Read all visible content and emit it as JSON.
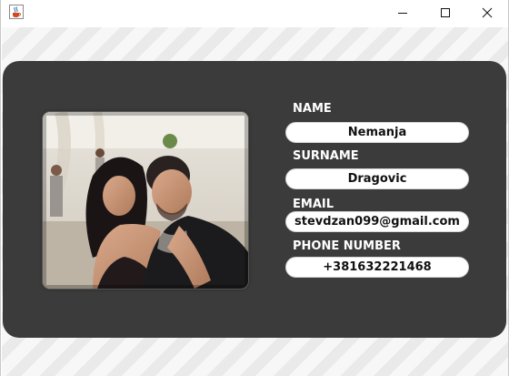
{
  "window": {
    "icon": "java-cup-icon",
    "controls": {
      "minimize_icon": "minimize-icon",
      "maximize_icon": "maximize-icon",
      "close_icon": "close-icon"
    }
  },
  "card": {
    "background_color": "#3b3b3b",
    "photo": {
      "description_icon": "profile-photo"
    },
    "fields": {
      "name": {
        "label": "NAME",
        "value": "Nemanja"
      },
      "surname": {
        "label": "SURNAME",
        "value": "Dragovic"
      },
      "email": {
        "label": "EMAIL",
        "value": "stevdzan099@gmail.com"
      },
      "phone": {
        "label": "PHONE NUMBER",
        "value": "+381632221468"
      }
    }
  }
}
